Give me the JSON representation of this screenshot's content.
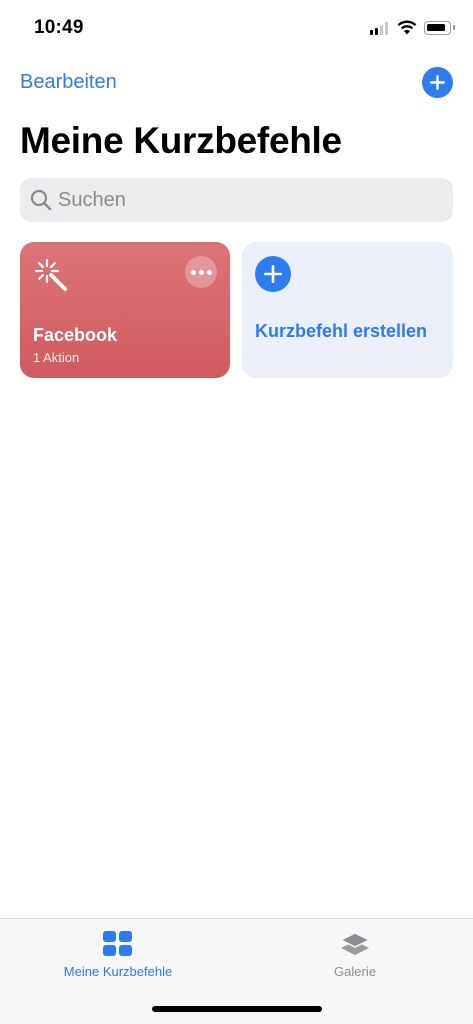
{
  "status_bar": {
    "time": "10:49",
    "icons": [
      "signal-icon",
      "wifi-icon",
      "battery-icon"
    ]
  },
  "nav": {
    "edit_label": "Bearbeiten",
    "add_icon": "plus-icon"
  },
  "page_title": "Meine Kurzbefehle",
  "search": {
    "placeholder": "Suchen",
    "icon": "search-icon"
  },
  "shortcuts": [
    {
      "title": "Facebook",
      "subtitle": "1 Aktion",
      "icon": "magic-wand-icon",
      "color": "#d8676a"
    }
  ],
  "create_card": {
    "label": "Kurzbefehl erstellen",
    "icon": "plus-icon",
    "color": "#ebeff9"
  },
  "tab_bar": {
    "tabs": [
      {
        "label": "Meine Kurzbefehle",
        "icon": "grid-icon",
        "active": true
      },
      {
        "label": "Galerie",
        "icon": "layers-icon",
        "active": false
      }
    ]
  },
  "colors": {
    "accent": "#2f7bf0",
    "inactive": "#8e8e93"
  }
}
